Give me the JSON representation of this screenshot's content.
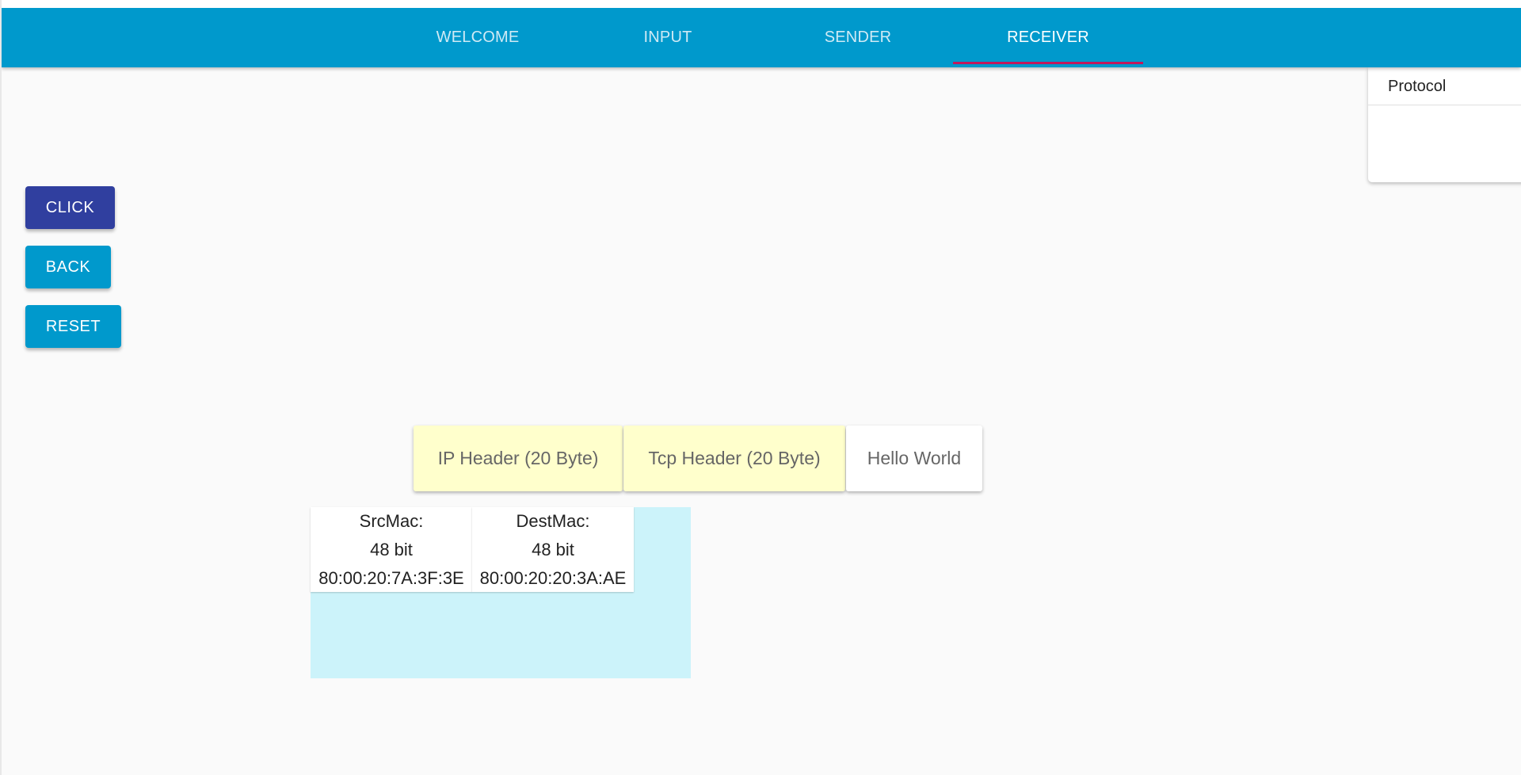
{
  "tabs": [
    {
      "label": "WELCOME",
      "active": false
    },
    {
      "label": "INPUT",
      "active": false
    },
    {
      "label": "SENDER",
      "active": false
    },
    {
      "label": "RECEIVER",
      "active": true
    }
  ],
  "protocol_panel": {
    "label": "Protocol"
  },
  "buttons": {
    "click_label": "CLICK",
    "back_label": "BACK",
    "reset_label": "RESET"
  },
  "packet": {
    "ip_header": "IP Header (20 Byte)",
    "tcp_header": "Tcp Header (20 Byte)",
    "payload": "Hello World"
  },
  "frame": {
    "src_mac": {
      "title": "SrcMac:",
      "size": "48 bit",
      "value": "80:00:20:7A:3F:3E"
    },
    "dest_mac": {
      "title": "DestMac:",
      "size": "48 bit",
      "value": "80:00:20:20:3A:AE"
    }
  },
  "colors": {
    "tab_bar": "#0099cc",
    "tab_indicator": "#c2185b",
    "click_button": "#303f9f",
    "action_button": "#0099cc",
    "header_segment": "#ffffcc",
    "frame_area": "#ccf3fa"
  }
}
